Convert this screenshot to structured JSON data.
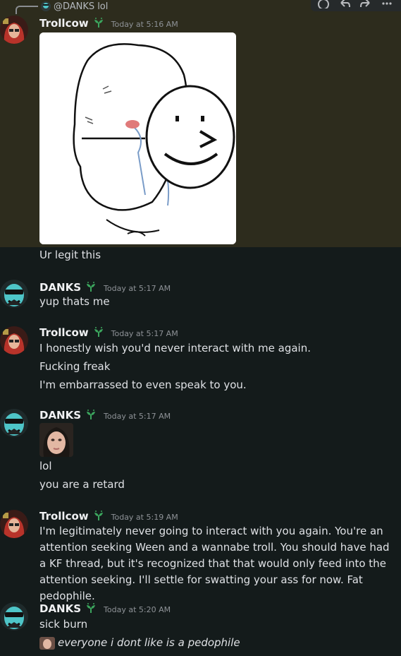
{
  "reply": {
    "mention": "@DANKS",
    "text": "lol"
  },
  "messages": [
    {
      "user": "Trollcow",
      "time": "Today at 5:16 AM",
      "lines": [
        "Ur legit this"
      ]
    },
    {
      "user": "DANKS",
      "time": "Today at 5:17 AM",
      "lines": [
        "yup thats me"
      ]
    },
    {
      "user": "Trollcow",
      "time": "Today at 5:17 AM",
      "lines": [
        "I honestly wish you'd never interact with me again.",
        "Fucking freak",
        "I'm embarrassed to even speak to you."
      ]
    },
    {
      "user": "DANKS",
      "time": "Today at 5:17 AM",
      "lines": [
        "lol",
        "you are a retard"
      ]
    },
    {
      "user": "Trollcow",
      "time": "Today at 5:19 AM",
      "lines": [
        "I'm legitimately never going to interact with you again. You're an attention seeking Ween and a wannabe troll. You should have had a KF thread, but it's recognized that that would only feed into the attention seeking. I'll settle for swatting your ass for now. Fat pedophile."
      ]
    },
    {
      "user": "DANKS",
      "time": "Today at 5:20 AM",
      "lines": [
        "sick burn",
        "everyone i dont like is a pedophile"
      ]
    }
  ],
  "colors": {
    "highlight": "#2d2c1d",
    "background": "#141b1b",
    "badge": "#3ba55d",
    "timestamp": "#8e9297"
  },
  "icons": [
    "reaction-icon",
    "reply-icon",
    "forward-icon",
    "more-icon",
    "sprout-badge-icon"
  ]
}
